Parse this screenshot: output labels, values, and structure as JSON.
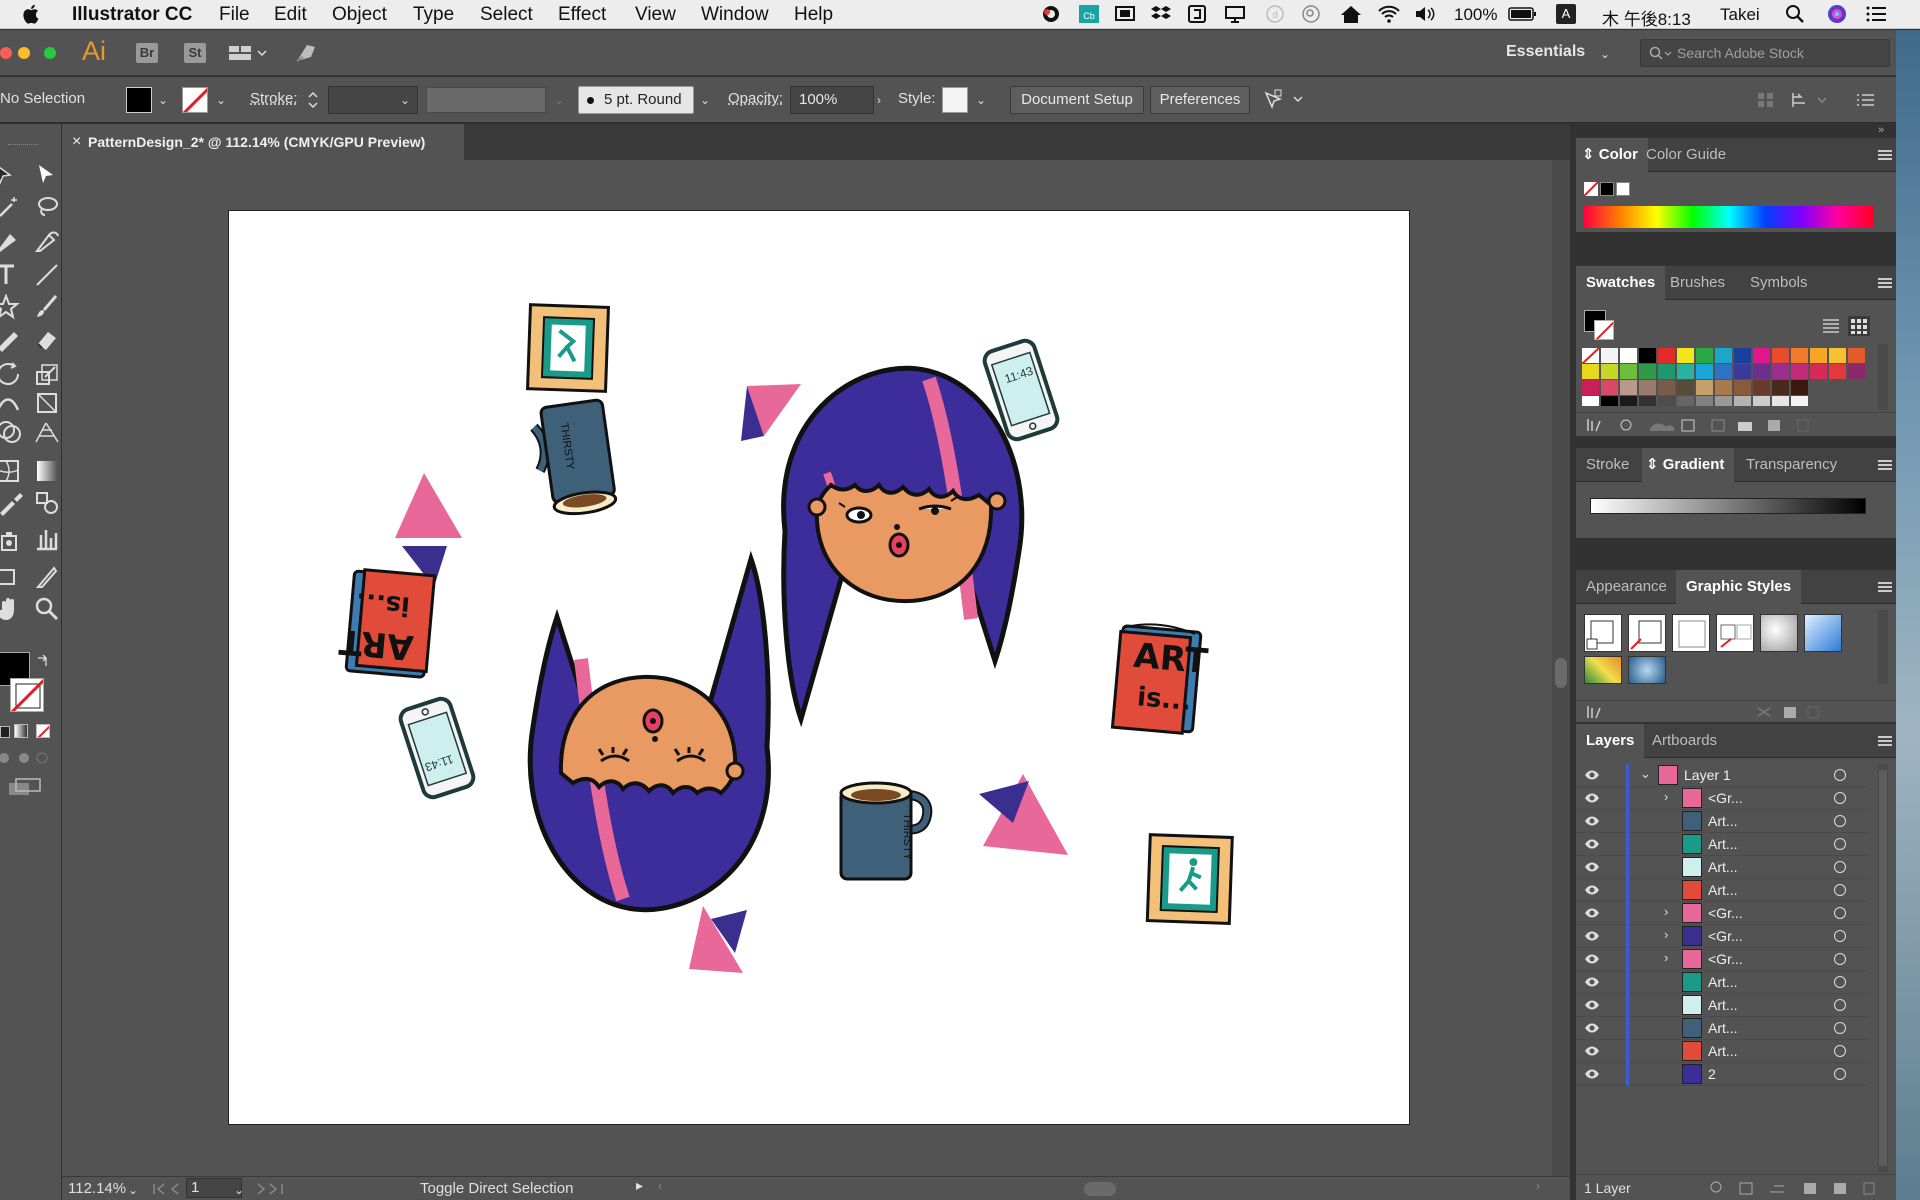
{
  "menubar": {
    "app_name": "Illustrator CC",
    "menus": [
      "File",
      "Edit",
      "Object",
      "Type",
      "Select",
      "Effect",
      "View",
      "Window",
      "Help"
    ],
    "battery": "100%",
    "input_method": "A",
    "clock": "木 午後8:13",
    "user": "Takei"
  },
  "appbar": {
    "logo": "Ai",
    "bridge": "Br",
    "stock": "St",
    "workspace": "Essentials",
    "search_placeholder": "Search Adobe Stock"
  },
  "control": {
    "selection": "No Selection",
    "stroke_label": "Stroke:",
    "brush": "5 pt. Round",
    "opacity_label": "Opacity:",
    "opacity_value": "100%",
    "style_label": "Style:",
    "doc_setup": "Document Setup",
    "preferences": "Preferences"
  },
  "document": {
    "tab_title": "PatternDesign_2* @ 112.14% (CMYK/GPU Preview)",
    "close": "×"
  },
  "status": {
    "zoom": "112.14%",
    "artboard_num": "1",
    "message": "Toggle Direct Selection"
  },
  "artwork": {
    "book_text_1": "ART",
    "book_text_2": "is...",
    "mug_text": "THIRSTY",
    "phone_time": "11:43"
  },
  "panels": {
    "color_tabs": [
      "Color",
      "Color Guide"
    ],
    "swatch_tabs": [
      "Swatches",
      "Brushes",
      "Symbols"
    ],
    "gradient_tabs": [
      "Stroke",
      "Gradient",
      "Transparency"
    ],
    "appearance_tabs": [
      "Appearance",
      "Graphic Styles"
    ],
    "layers_tabs": [
      "Layers",
      "Artboards"
    ],
    "layers_footer": "1 Layer"
  },
  "layers": [
    {
      "name": "Layer 1",
      "expand": "v"
    },
    {
      "name": "<Gr...",
      "expand": ">"
    },
    {
      "name": "Art...",
      "expand": ""
    },
    {
      "name": "Art...",
      "expand": ""
    },
    {
      "name": "Art...",
      "expand": ""
    },
    {
      "name": "Art...",
      "expand": ""
    },
    {
      "name": "<Gr...",
      "expand": ">"
    },
    {
      "name": "<Gr...",
      "expand": ">"
    },
    {
      "name": "<Gr...",
      "expand": ">"
    },
    {
      "name": "Art...",
      "expand": ""
    },
    {
      "name": "Art...",
      "expand": ""
    },
    {
      "name": "Art...",
      "expand": ""
    },
    {
      "name": "Art...",
      "expand": ""
    },
    {
      "name": "2",
      "expand": ""
    }
  ],
  "colors": {
    "pink": "#e8689a",
    "navy": "#3a2f8f",
    "hair": "#3d2d9a",
    "skin": "#e89a62",
    "teal": "#1a9b8a",
    "red": "#e14b3a",
    "frame": "#f2c079",
    "mug": "#3e6079"
  }
}
